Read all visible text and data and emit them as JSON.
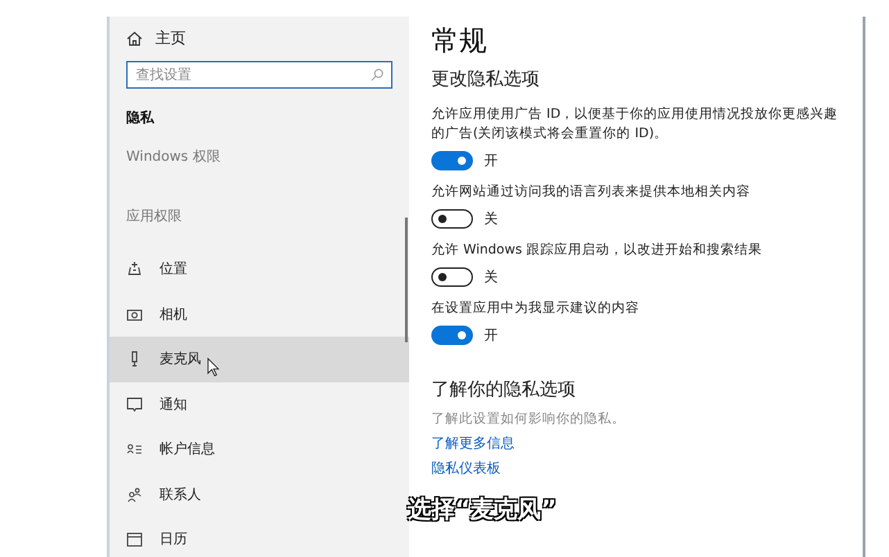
{
  "sidebar": {
    "home": "主页",
    "search": {
      "placeholder": "查找设置"
    },
    "section_title": "隐私",
    "groups": [
      "Windows 权限",
      "应用权限"
    ],
    "items": [
      {
        "label": "位置",
        "kind": "location",
        "selected": false
      },
      {
        "label": "相机",
        "kind": "camera",
        "selected": false
      },
      {
        "label": "麦克风",
        "kind": "mic",
        "selected": true
      },
      {
        "label": "通知",
        "kind": "notify",
        "selected": false
      },
      {
        "label": "帐户信息",
        "kind": "account",
        "selected": false
      },
      {
        "label": "联系人",
        "kind": "contacts",
        "selected": false
      },
      {
        "label": "日历",
        "kind": "calendar",
        "selected": false
      }
    ]
  },
  "content": {
    "title": "常规",
    "subtitle": "更改隐私选项",
    "settings": [
      {
        "description": "允许应用使用广告 ID，以便基于你的应用使用情况投放你更感兴趣的广告(关闭该模式将会重置你的 ID)。",
        "on": true,
        "state_text": "开"
      },
      {
        "description": "允许网站通过访问我的语言列表来提供本地相关内容",
        "on": false,
        "state_text": "关"
      },
      {
        "description": "允许 Windows 跟踪应用启动，以改进开始和搜索结果",
        "on": false,
        "state_text": "关"
      },
      {
        "description": "在设置应用中为我显示建议的内容",
        "on": true,
        "state_text": "开"
      }
    ],
    "learn_title": "了解你的隐私选项",
    "learn_text": "了解此设置如何影响你的隐私。",
    "links": [
      "了解更多信息",
      "隐私仪表板"
    ]
  },
  "caption": "选择“麦克风”"
}
